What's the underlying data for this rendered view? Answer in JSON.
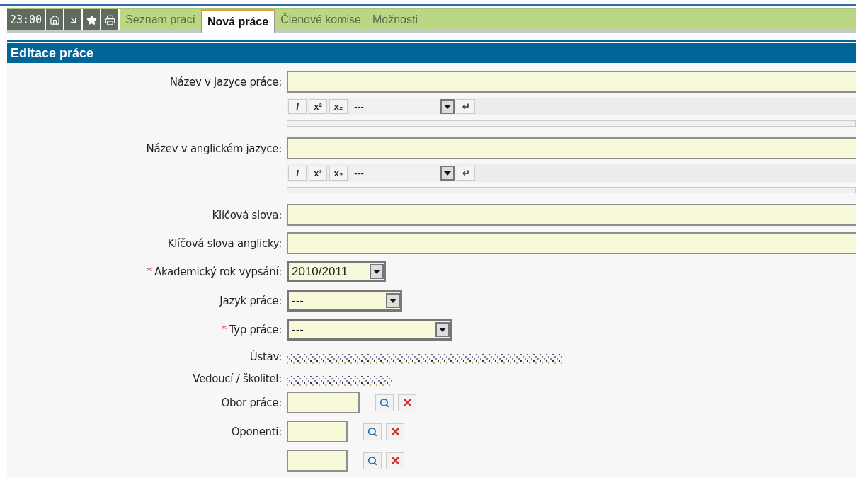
{
  "toolbar": {
    "time": "23:00"
  },
  "tabs": [
    {
      "label": "Seznam prací",
      "selected": false
    },
    {
      "label": "Nová práce",
      "selected": true
    },
    {
      "label": "Členové komise",
      "selected": false
    },
    {
      "label": "Možnosti",
      "selected": false
    }
  ],
  "section": {
    "title": "Editace práce"
  },
  "fields": [
    {
      "kind": "richtext",
      "label": "Název v jazyce práce:",
      "format_buttons": [
        "I",
        "x²",
        "x₂"
      ],
      "style_select": "---",
      "enter_button": "↵"
    },
    {
      "kind": "richtext",
      "label": "Název v anglickém jazyce:",
      "format_buttons": [
        "I",
        "x²",
        "x₂"
      ],
      "style_select": "---",
      "enter_button": "↵"
    },
    {
      "kind": "text",
      "label": "Klíčová slova:"
    },
    {
      "kind": "text",
      "label": "Klíčová slova anglicky:"
    },
    {
      "kind": "select",
      "label": "Akademický rok vypsání:",
      "mark": "*",
      "value": "2010/2011"
    },
    {
      "kind": "select",
      "label": "Jazyk práce:",
      "value": "---"
    },
    {
      "kind": "select",
      "label": "Typ práce:",
      "mark": "*",
      "value": "---"
    },
    {
      "kind": "redacted",
      "label": "Ústav:"
    },
    {
      "kind": "redacted",
      "label": "Vedoucí / školitel:"
    },
    {
      "kind": "lookup",
      "label": "Obor práce:"
    },
    {
      "kind": "lookup",
      "label": "Oponenti:"
    },
    {
      "kind": "lookup"
    }
  ]
}
